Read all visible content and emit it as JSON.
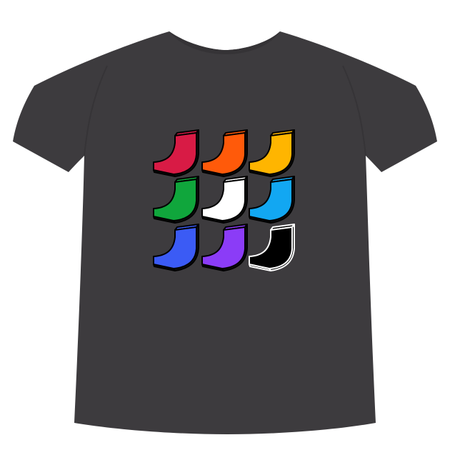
{
  "shirt": {
    "color": "#3d3b3e"
  },
  "design": {
    "outline_color": "#000000",
    "tiles": [
      {
        "name": "red",
        "color": "#d81b45"
      },
      {
        "name": "orange",
        "color": "#ff5a0a"
      },
      {
        "name": "yellow",
        "color": "#ffb500"
      },
      {
        "name": "green",
        "color": "#10a63c"
      },
      {
        "name": "white",
        "color": "#ffffff"
      },
      {
        "name": "light-blue",
        "color": "#12a7f2"
      },
      {
        "name": "blue",
        "color": "#3b5bf5"
      },
      {
        "name": "purple",
        "color": "#8b3cf7"
      },
      {
        "name": "black",
        "color": "#000000",
        "outline": "#ffffff"
      }
    ]
  }
}
